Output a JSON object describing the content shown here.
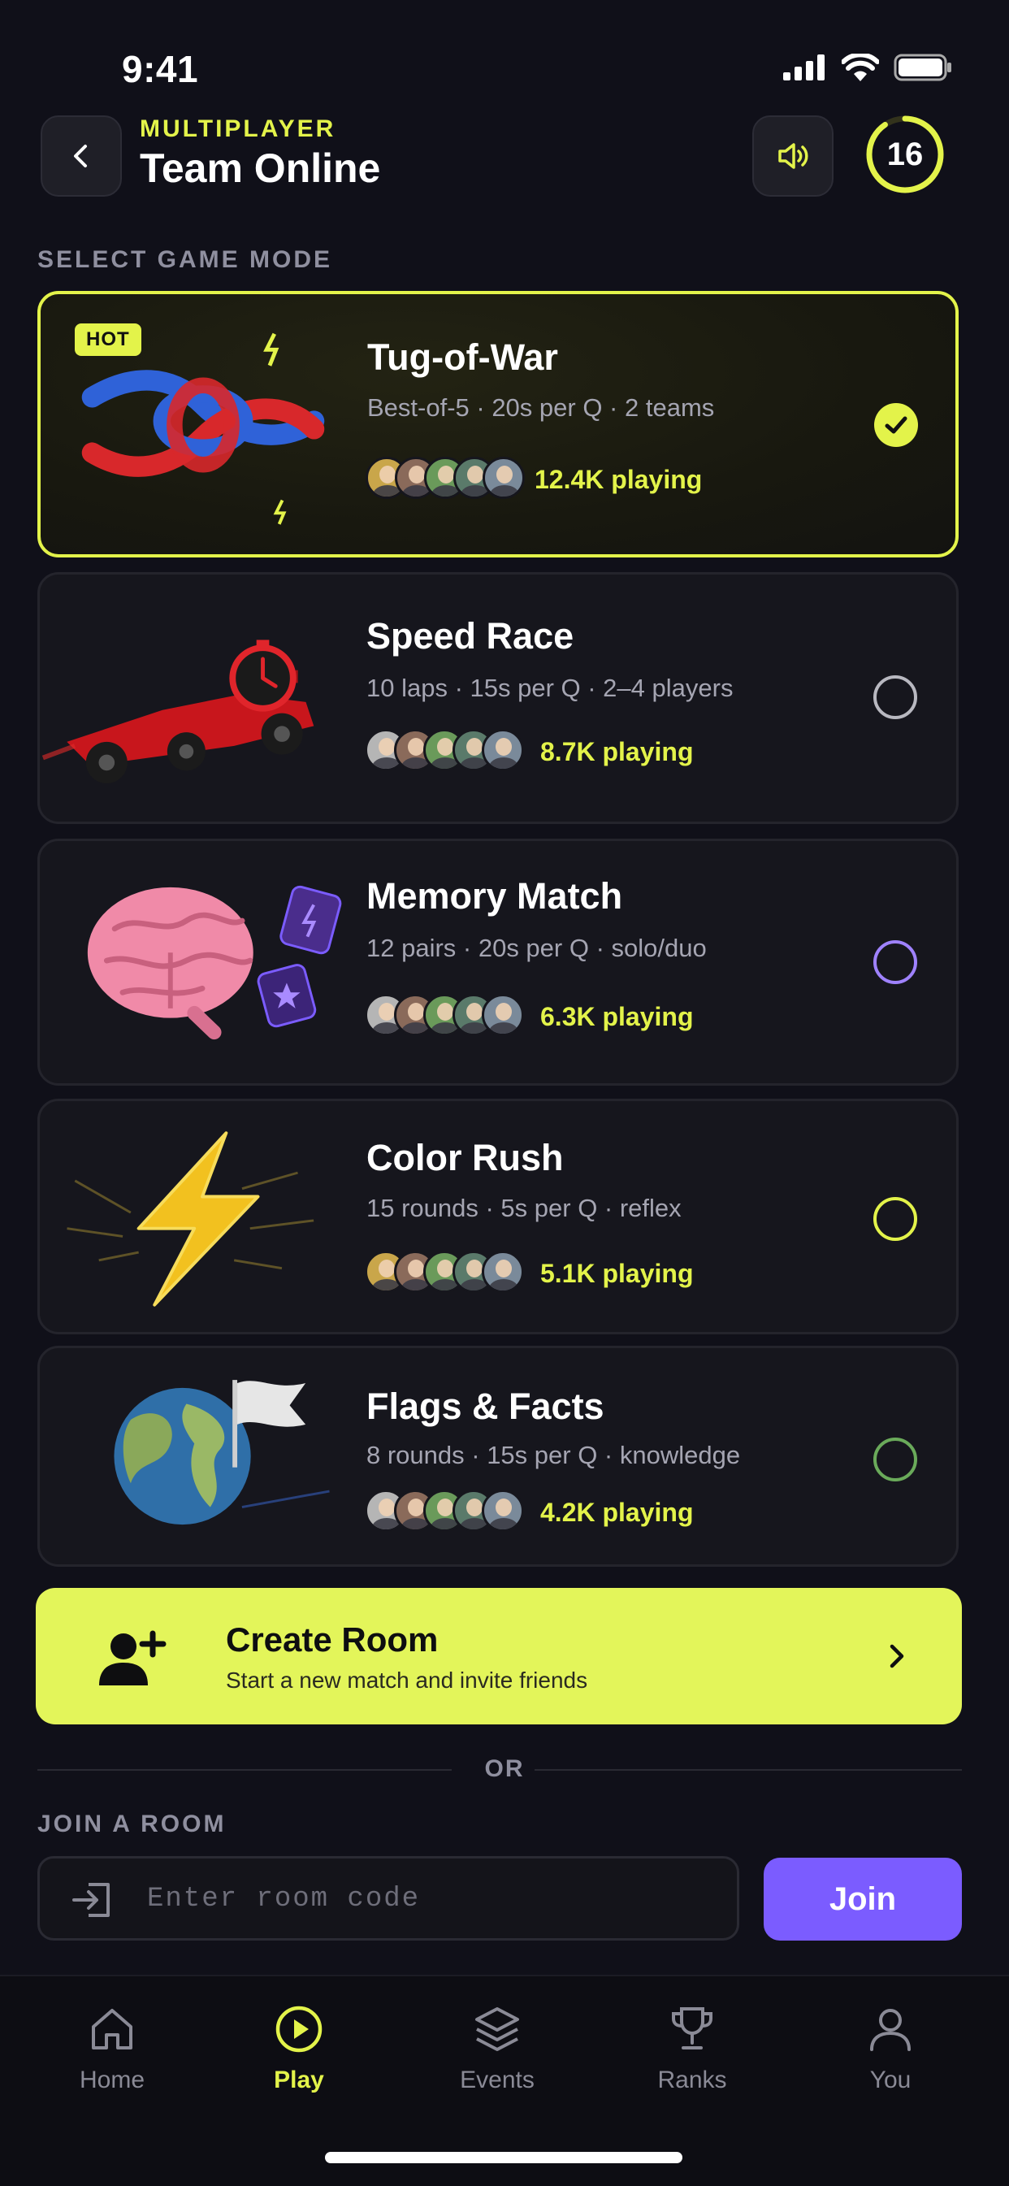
{
  "status": {
    "time": "9:41"
  },
  "header": {
    "eyebrow": "MULTIPLAYER",
    "title": "Team Online",
    "timer": "16"
  },
  "section_label": "SELECT GAME MODE",
  "modes": [
    {
      "title": "Tug-of-War",
      "meta": "Best-of-5 · 20s per Q · 2 teams",
      "playing": "12.4K playing",
      "badge": "HOT",
      "selected": true
    },
    {
      "title": "Speed Race",
      "meta": "10 laps · 15s per Q · 2–4 players",
      "playing": "8.7K playing"
    },
    {
      "title": "Memory Match",
      "meta": "12 pairs · 20s per Q · solo/duo",
      "playing": "6.3K playing"
    },
    {
      "title": "Color Rush",
      "meta": "15 rounds · 5s per Q · reflex",
      "playing": "5.1K playing"
    },
    {
      "title": "Flags & Facts",
      "meta": "8 rounds · 15s per Q · knowledge",
      "playing": "4.2K playing"
    }
  ],
  "create_room": {
    "title": "Create Room",
    "subtitle": "Start a new match and invite friends"
  },
  "or_text": "OR",
  "join": {
    "label": "JOIN A ROOM",
    "placeholder": "Enter room code",
    "button": "Join"
  },
  "tabs": [
    {
      "label": "Home",
      "icon": "home-icon"
    },
    {
      "label": "Play",
      "icon": "play-icon",
      "active": true
    },
    {
      "label": "Events",
      "icon": "layers-icon"
    },
    {
      "label": "Ranks",
      "icon": "trophy-icon"
    },
    {
      "label": "You",
      "icon": "user-icon"
    }
  ],
  "colors": {
    "accent": "#e3f34a",
    "join": "#7b5cff",
    "background": "#101019"
  }
}
